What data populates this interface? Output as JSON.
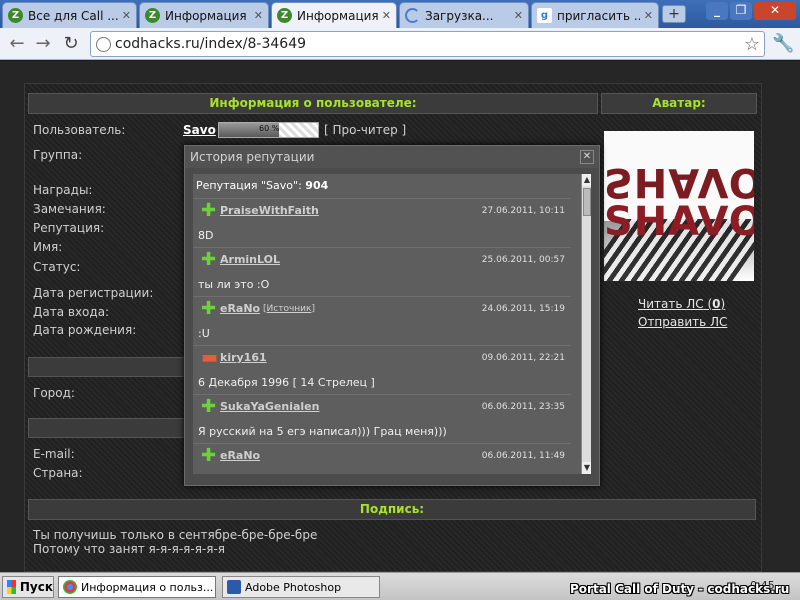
{
  "browser": {
    "tabs": [
      {
        "title": "Все для Call ...",
        "active": false,
        "icon": "site-favicon"
      },
      {
        "title": "Информация ...",
        "active": false,
        "icon": "site-favicon"
      },
      {
        "title": "Информация ...",
        "active": true,
        "icon": "site-favicon"
      },
      {
        "title": "Загрузка...",
        "active": false,
        "icon": "loading-spinner"
      },
      {
        "title": "пригласить ...",
        "active": false,
        "icon": "google-favicon"
      }
    ],
    "new_tab": "+",
    "url": "codhacks.ru/index/8-34649"
  },
  "profile": {
    "header_info": "Информация о пользователе:",
    "header_avatar": "Аватар:",
    "username_label": "Пользователь:",
    "username": "Savo",
    "rep_bar_text": "60 %",
    "rank": "[ Про-читер ]",
    "labels": {
      "group": "Группа:",
      "awards": "Награды:",
      "warnings": "Замечания:",
      "reputation": "Репутация:",
      "name": "Имя:",
      "status": "Статус:",
      "registered": "Дата регистрации:",
      "login": "Дата входа:",
      "birthday": "Дата рождения:",
      "city": "Город:",
      "email": "E-mail:",
      "country": "Страна:"
    },
    "avatar_text": "SHAVO",
    "read_pm": "Читать ЛС",
    "read_pm_count": "0",
    "send_pm": "Отправить ЛС",
    "signature_header": "Подпись:",
    "signature_lines": [
      "Ты получишь только в сентябре-бре-бре-бре",
      "Потому что занят я-я-я-я-я-я-я"
    ]
  },
  "modal": {
    "title": "История репутации",
    "summary_prefix": "Репутация \"Savo\":",
    "summary_value": "904",
    "entries": [
      {
        "sign": "plus",
        "user": "PraiseWithFaith",
        "date": "27.06.2011, 10:11",
        "comment": "8D",
        "source": ""
      },
      {
        "sign": "plus",
        "user": "ArminLOL",
        "date": "25.06.2011, 00:57",
        "comment": "ты ли это :O",
        "source": ""
      },
      {
        "sign": "plus",
        "user": "eRaNo",
        "date": "24.06.2011, 15:19",
        "comment": ":U",
        "source": "Источник"
      },
      {
        "sign": "minus",
        "user": "kiry161",
        "date": "09.06.2011, 22:21",
        "comment": "6 Декабря 1996 [ 14 Стрелец ]",
        "source": ""
      },
      {
        "sign": "plus",
        "user": "SukaYaGenialen",
        "date": "06.06.2011, 23:35",
        "comment": "Я русский на 5 егэ написал))) Грац меня)))",
        "source": ""
      },
      {
        "sign": "plus",
        "user": "eRaNo",
        "date": "06.06.2011, 11:49",
        "comment": "",
        "source": ""
      }
    ]
  },
  "taskbar": {
    "start": "Пуск",
    "tasks": [
      {
        "title": "Информация о польз...",
        "active": true
      },
      {
        "title": "Adobe Photoshop",
        "active": false
      }
    ],
    "overlay": "Portal Call of Duty - codhacks.ru",
    "clock": "0:45"
  },
  "colors": {
    "accent": "#a6e22e",
    "plus": "#6bd23a",
    "minus": "#e85c3c"
  }
}
